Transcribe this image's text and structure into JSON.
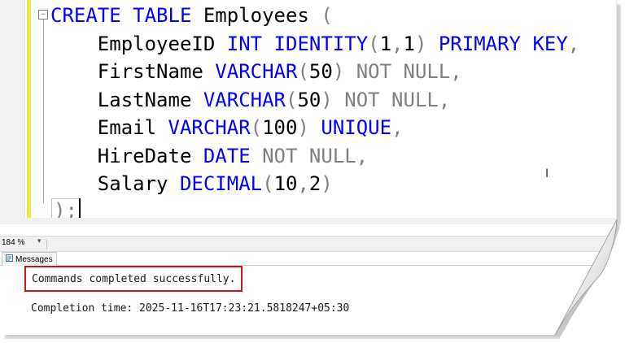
{
  "editor": {
    "code_lines": [
      [
        {
          "t": "CREATE TABLE",
          "c": "kw"
        },
        {
          "t": " Employees ",
          "c": "blk"
        },
        {
          "t": "(",
          "c": "gray"
        }
      ],
      [
        {
          "t": "    EmployeeID ",
          "c": "blk"
        },
        {
          "t": "INT IDENTITY",
          "c": "kw"
        },
        {
          "t": "(",
          "c": "gray"
        },
        {
          "t": "1",
          "c": "blk"
        },
        {
          "t": ",",
          "c": "gray"
        },
        {
          "t": "1",
          "c": "blk"
        },
        {
          "t": ")",
          "c": "gray"
        },
        {
          "t": " PRIMARY KEY",
          "c": "kw"
        },
        {
          "t": ",",
          "c": "gray"
        }
      ],
      [
        {
          "t": "    FirstName ",
          "c": "blk"
        },
        {
          "t": "VARCHAR",
          "c": "kw"
        },
        {
          "t": "(",
          "c": "gray"
        },
        {
          "t": "50",
          "c": "blk"
        },
        {
          "t": ")",
          "c": "gray"
        },
        {
          "t": " NOT NULL,",
          "c": "gray"
        }
      ],
      [
        {
          "t": "    LastName ",
          "c": "blk"
        },
        {
          "t": "VARCHAR",
          "c": "kw"
        },
        {
          "t": "(",
          "c": "gray"
        },
        {
          "t": "50",
          "c": "blk"
        },
        {
          "t": ")",
          "c": "gray"
        },
        {
          "t": " NOT NULL,",
          "c": "gray"
        }
      ],
      [
        {
          "t": "    Email ",
          "c": "blk"
        },
        {
          "t": "VARCHAR",
          "c": "kw"
        },
        {
          "t": "(",
          "c": "gray"
        },
        {
          "t": "100",
          "c": "blk"
        },
        {
          "t": ")",
          "c": "gray"
        },
        {
          "t": " UNIQUE",
          "c": "kw"
        },
        {
          "t": ",",
          "c": "gray"
        }
      ],
      [
        {
          "t": "    HireDate ",
          "c": "blk"
        },
        {
          "t": "DATE",
          "c": "kw"
        },
        {
          "t": " NOT NULL,",
          "c": "gray"
        }
      ],
      [
        {
          "t": "    Salary ",
          "c": "blk"
        },
        {
          "t": "DECIMAL",
          "c": "kw"
        },
        {
          "t": "(",
          "c": "gray"
        },
        {
          "t": "10",
          "c": "blk"
        },
        {
          "t": ",",
          "c": "gray"
        },
        {
          "t": "2",
          "c": "blk"
        },
        {
          "t": ")",
          "c": "gray"
        }
      ]
    ],
    "end_line": ");",
    "collapse_symbol": "−",
    "colors": {
      "keyword": "#0000ff",
      "punctuation": "#808080",
      "identifier": "#000000",
      "change_bar": "#f4e342"
    }
  },
  "statusbar": {
    "zoom": "184 %",
    "zoom_arrow": "▾"
  },
  "results": {
    "tab_label": "Messages",
    "tab_icon": "messages-icon",
    "success_message": "Commands completed successfully.",
    "completion_time": "Completion time: 2025-11-16T17:23:21.5818247+05:30",
    "highlight_color": "#d0121e"
  }
}
